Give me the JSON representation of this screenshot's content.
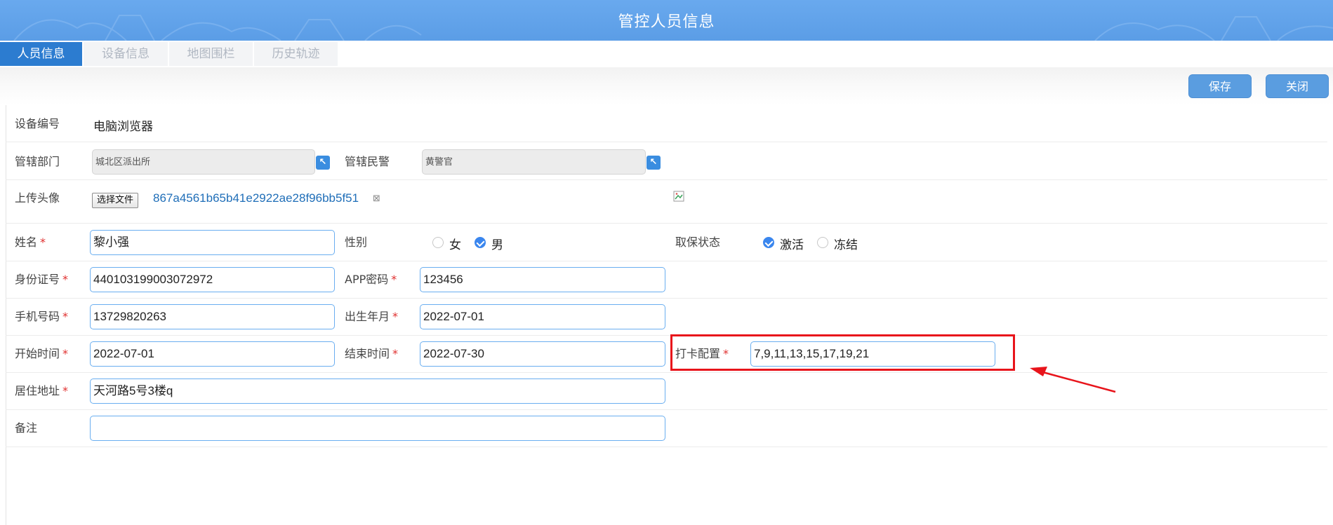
{
  "header": {
    "title": "管控人员信息"
  },
  "tabs": [
    {
      "label": "人员信息",
      "active": true
    },
    {
      "label": "设备信息",
      "active": false
    },
    {
      "label": "地图围栏",
      "active": false
    },
    {
      "label": "历史轨迹",
      "active": false
    }
  ],
  "toolbar": {
    "save_label": "保存",
    "close_label": "关闭"
  },
  "form": {
    "device_no": {
      "label": "设备编号",
      "value": "电脑浏览器"
    },
    "department": {
      "label": "管辖部门",
      "value": "城北区派出所",
      "picker_icon": "arrow-up-left-icon"
    },
    "officer": {
      "label": "管辖民警",
      "value": "黄警官",
      "picker_icon": "arrow-up-left-icon"
    },
    "avatar": {
      "label": "上传头像",
      "choose_file_label": "选择文件",
      "file_name": "867a4561b65b41e2922ae28f96bb5f51",
      "remove_icon": "⊠"
    },
    "name": {
      "label": "姓名",
      "required_mark": "*",
      "value": "黎小强"
    },
    "gender": {
      "label": "性别",
      "options": [
        {
          "label": "女",
          "checked": false
        },
        {
          "label": "男",
          "checked": true
        }
      ]
    },
    "bail_status": {
      "label": "取保状态",
      "options": [
        {
          "label": "激活",
          "checked": true
        },
        {
          "label": "冻结",
          "checked": false
        }
      ]
    },
    "id_number": {
      "label": "身份证号",
      "required_mark": "*",
      "value": "440103199003072972"
    },
    "app_password": {
      "label": "APP密码",
      "required_mark": "*",
      "value": "123456"
    },
    "phone": {
      "label": "手机号码",
      "required_mark": "*",
      "value": "13729820263"
    },
    "birth": {
      "label": "出生年月",
      "required_mark": "*",
      "value": "2022-07-01"
    },
    "start_time": {
      "label": "开始时间",
      "required_mark": "*",
      "value": "2022-07-01"
    },
    "end_time": {
      "label": "结束时间",
      "required_mark": "*",
      "value": "2022-07-30"
    },
    "checkin_config": {
      "label": "打卡配置",
      "required_mark": "*",
      "value": "7,9,11,13,15,17,19,21"
    },
    "address": {
      "label": "居住地址",
      "required_mark": "*",
      "value": "天河路5号3楼q"
    },
    "remark": {
      "label": "备注",
      "value": ""
    }
  },
  "annotation": {
    "highlight_color": "#e8141b"
  },
  "colors": {
    "header_bg": "#5b9de6",
    "tab_active": "#2c7cd0",
    "button_bg": "#5a9de0",
    "input_border": "#6aaef0",
    "radio_checked": "#3a86ee"
  }
}
